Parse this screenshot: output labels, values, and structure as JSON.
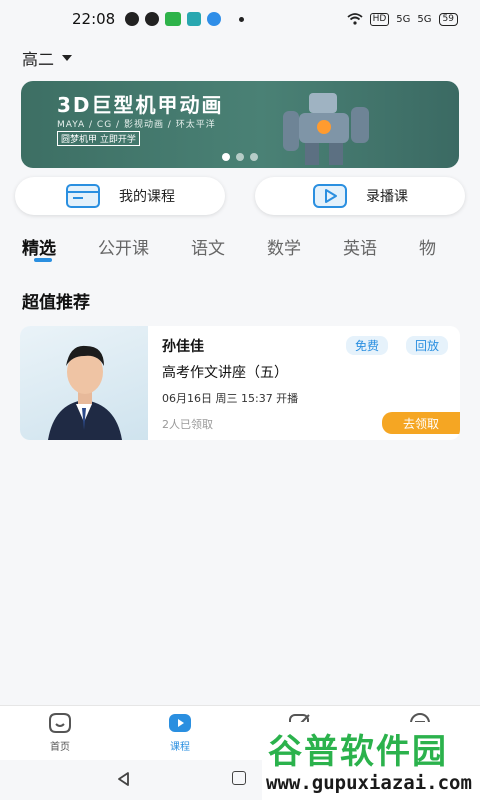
{
  "status_bar": {
    "time": "22:08",
    "net1": "HD",
    "net2": "5G",
    "net3": "5G",
    "battery": "59"
  },
  "grade_selector": {
    "label": "高二"
  },
  "banner": {
    "title": "3D巨型机甲动画",
    "subtitle": "MAYA / CG / 影视动画 / 环太平洋",
    "tag": "圆梦机甲 立即开学"
  },
  "quick_links": [
    {
      "label": "我的课程",
      "icon": "course-card-icon"
    },
    {
      "label": "录播课",
      "icon": "play-icon"
    }
  ],
  "tabs": [
    "精选",
    "公开课",
    "语文",
    "数学",
    "英语",
    "物"
  ],
  "section": {
    "title": "超值推荐"
  },
  "course_card": {
    "teacher": "孙佳佳",
    "badge_free": "免费",
    "badge_replay": "回放",
    "title": "高考作文讲座（五）",
    "time": "06月16日 周三 15:37 开播",
    "claimed": "2人已领取",
    "cta": "去领取"
  },
  "bottom_nav": [
    {
      "label": "首页",
      "icon": "home-icon"
    },
    {
      "label": "课程",
      "icon": "course-play-icon"
    },
    {
      "label": "",
      "icon": "edit-icon"
    },
    {
      "label": "",
      "icon": "profile-icon"
    }
  ],
  "watermark": {
    "cn": "谷普软件园",
    "url": "www.gupuxiazai.com"
  },
  "colors": {
    "accent": "#2a8fe0",
    "cta": "#f5a623",
    "watermark_green": "#2bb24c"
  }
}
